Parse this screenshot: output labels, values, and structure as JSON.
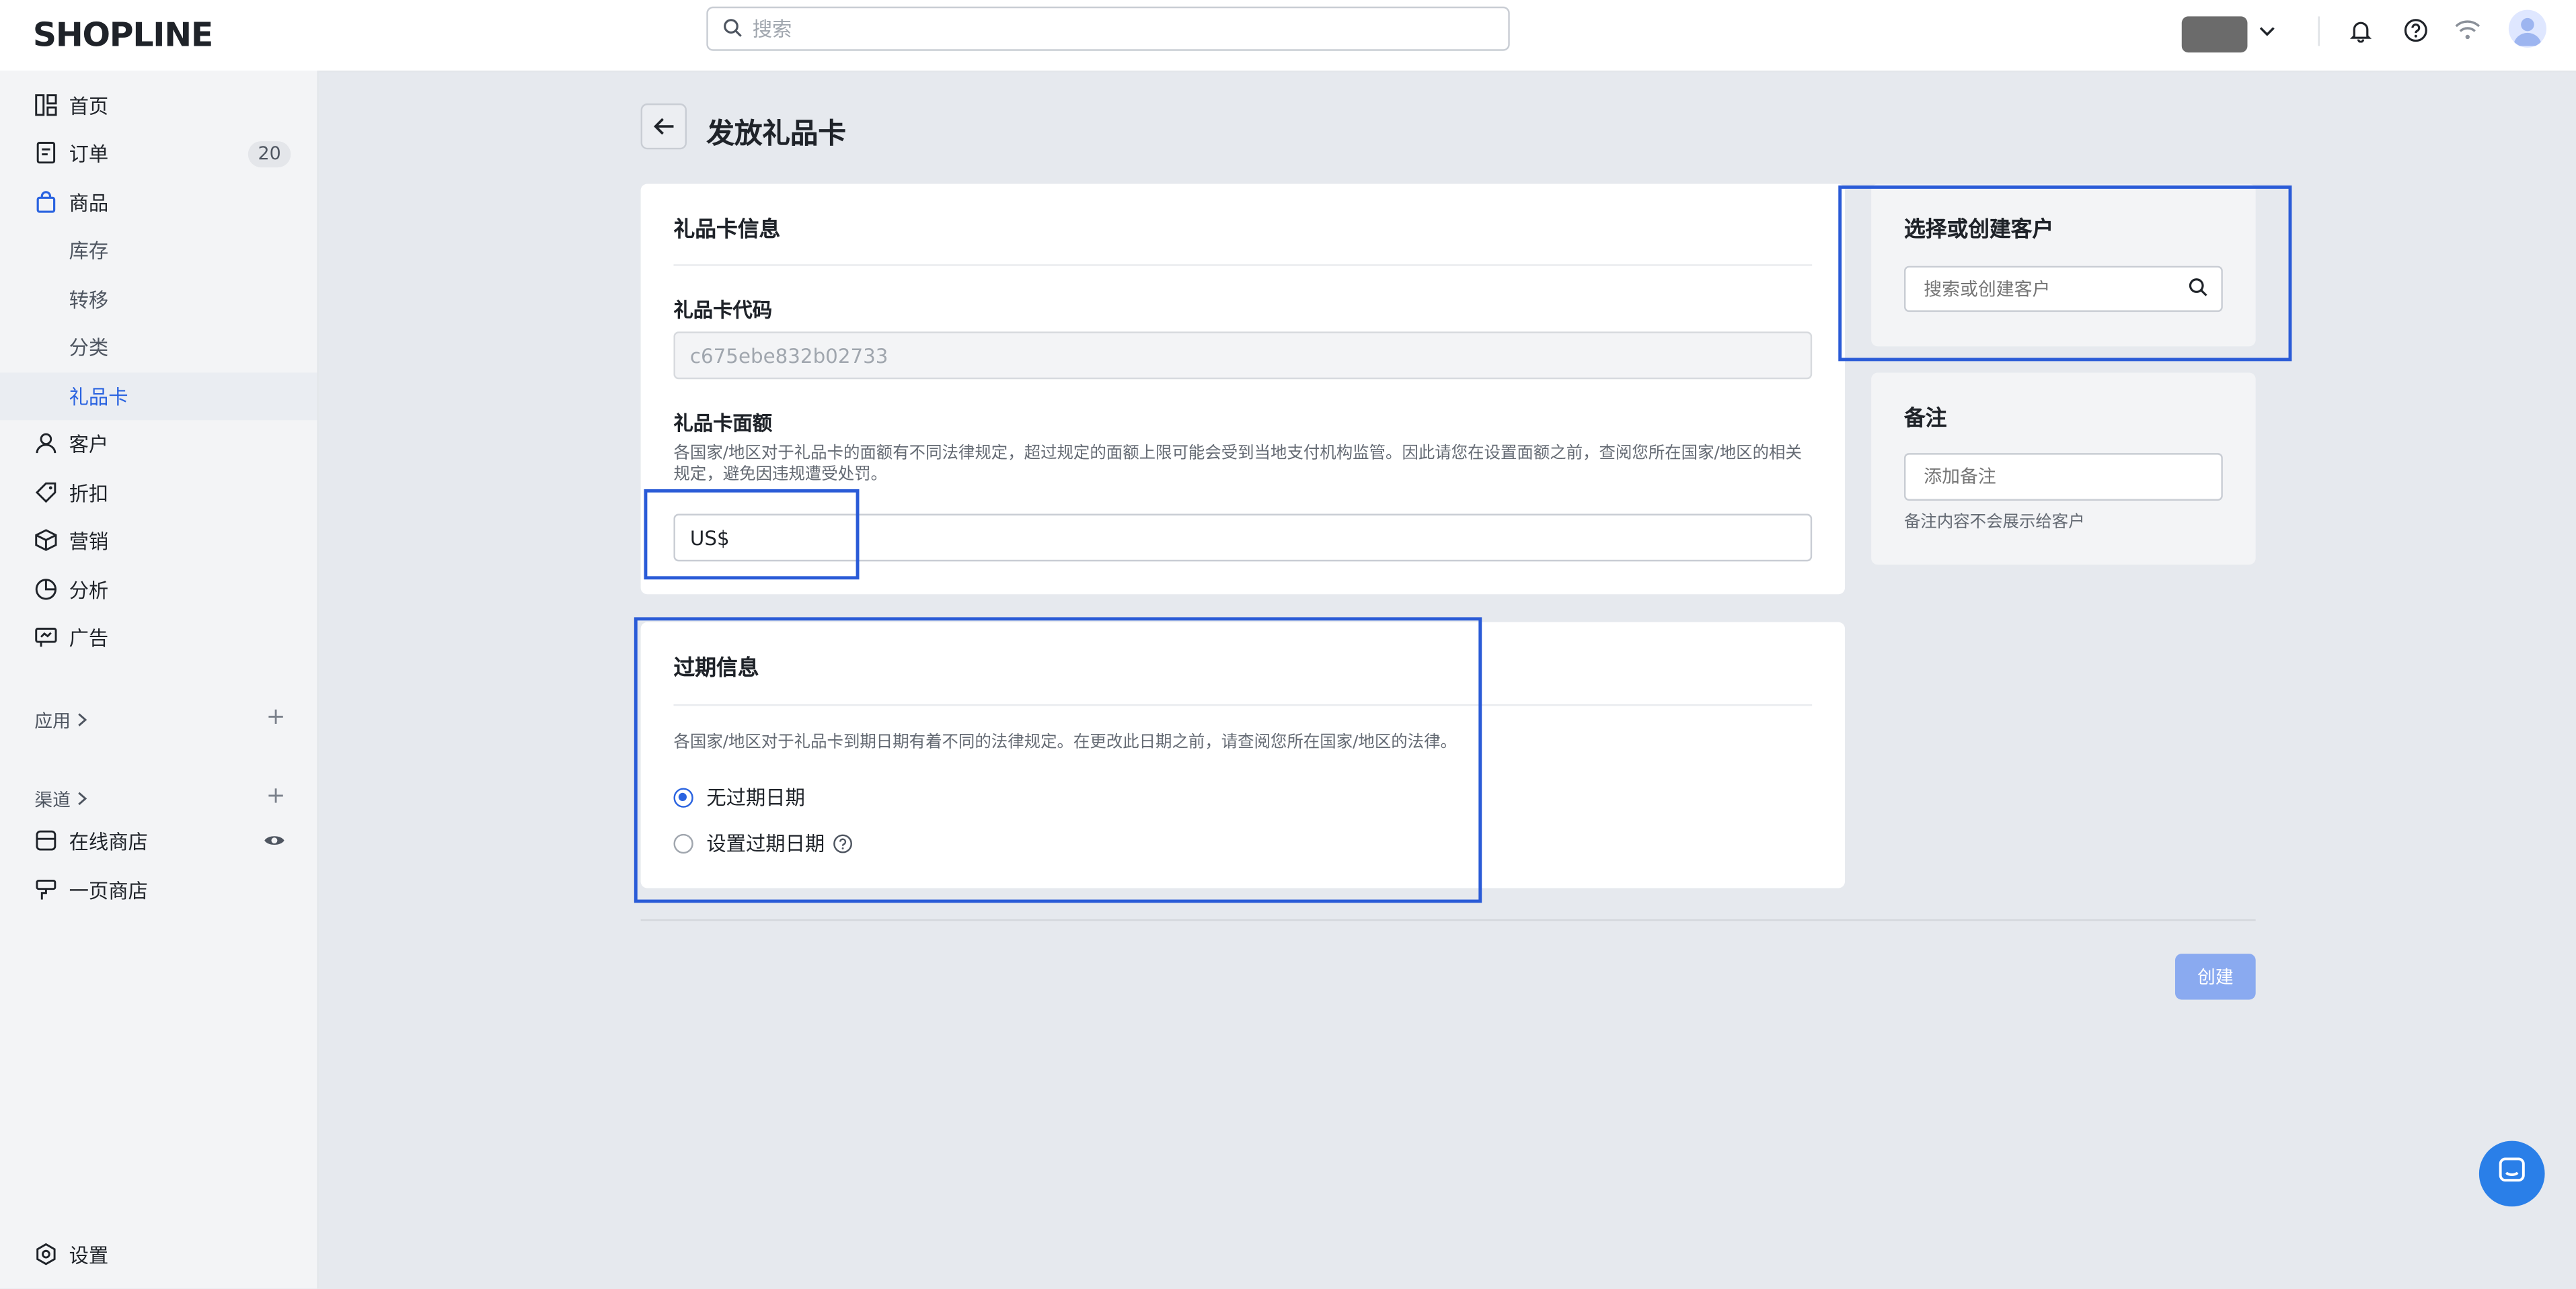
{
  "brand": {
    "logo_text": "SHOPLINE",
    "accent": "#2a63e0"
  },
  "topbar": {
    "search_placeholder": "搜索"
  },
  "sidebar": {
    "items": [
      {
        "label": "首页",
        "icon": "home-icon"
      },
      {
        "label": "订单",
        "icon": "order-icon",
        "badge": "20"
      },
      {
        "label": "商品",
        "icon": "bag-icon"
      },
      {
        "label": "库存"
      },
      {
        "label": "转移"
      },
      {
        "label": "分类"
      },
      {
        "label": "礼品卡"
      },
      {
        "label": "客户",
        "icon": "person-icon"
      },
      {
        "label": "折扣",
        "icon": "tag-icon"
      },
      {
        "label": "营销",
        "icon": "marketing-icon"
      },
      {
        "label": "分析",
        "icon": "analytics-icon"
      },
      {
        "label": "广告",
        "icon": "ad-icon"
      }
    ],
    "apps_label": "应用",
    "channels_label": "渠道",
    "channels": [
      {
        "label": "在线商店",
        "icon": "store-icon"
      },
      {
        "label": "一页商店",
        "icon": "one-page-icon"
      }
    ],
    "settings_label": "设置"
  },
  "page": {
    "title": "发放礼品卡"
  },
  "giftcard_info": {
    "title": "礼品卡信息",
    "code_label": "礼品卡代码",
    "code_value": "c675ebe832b02733",
    "amount_label": "礼品卡面额",
    "amount_help": "各国家/地区对于礼品卡的面额有不同法律规定，超过规定的面额上限可能会受到当地支付机构监管。因此请您在设置面额之前，查阅您所在国家/地区的相关规定，避免因违规遭受处罚。",
    "currency_prefix": "US$"
  },
  "expiry": {
    "title": "过期信息",
    "help": "各国家/地区对于礼品卡到期日期有着不同的法律规定。在更改此日期之前，请查阅您所在国家/地区的法律。",
    "option_none": "无过期日期",
    "option_set": "设置过期日期"
  },
  "customer": {
    "title": "选择或创建客户",
    "search_placeholder": "搜索或创建客户"
  },
  "notes": {
    "title": "备注",
    "placeholder": "添加备注",
    "help": "备注内容不会展示给客户"
  },
  "actions": {
    "create_label": "创建"
  }
}
